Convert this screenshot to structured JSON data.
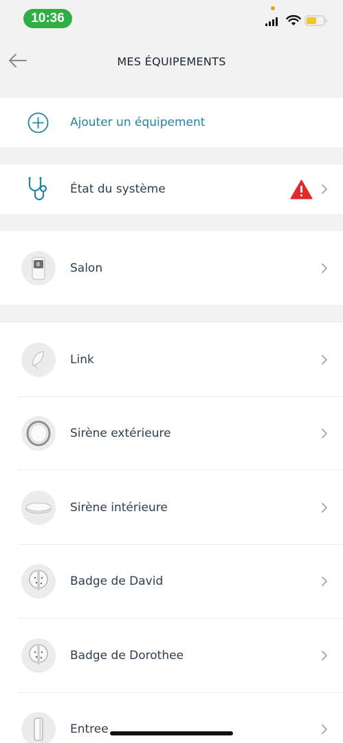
{
  "status_bar": {
    "time": "10:36"
  },
  "header": {
    "title": "MES ÉQUIPEMENTS"
  },
  "add": {
    "label": "Ajouter un équipement"
  },
  "system": {
    "label": "État du système",
    "alert_color": "#e32a2a"
  },
  "main_device": {
    "label": "Salon"
  },
  "devices": [
    {
      "label": "Link",
      "icon": "link-device-icon"
    },
    {
      "label": "Sirène extérieure",
      "icon": "outdoor-siren-icon"
    },
    {
      "label": "Sirène intérieure",
      "icon": "indoor-siren-icon"
    },
    {
      "label": "Badge de David",
      "icon": "badge-icon"
    },
    {
      "label": "Badge de Dorothee",
      "icon": "badge-icon"
    },
    {
      "label": "Entree",
      "icon": "door-sensor-icon"
    }
  ],
  "colors": {
    "accent": "#2383a6",
    "time_pill": "#2fae45",
    "battery": "#f4c52a"
  }
}
